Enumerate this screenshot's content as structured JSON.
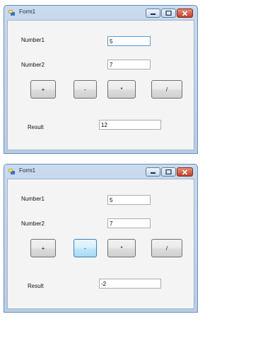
{
  "windows": [
    {
      "title": "Form1",
      "number1_label": "Number1",
      "number1_value": "5",
      "number2_label": "Number2",
      "number2_value": "7",
      "buttons": {
        "add": "+",
        "subtract": "-",
        "multiply": "*",
        "divide": "/"
      },
      "result_label": "Result",
      "result_value": "12"
    },
    {
      "title": "Form1",
      "number1_label": "Number1",
      "number1_value": "5",
      "number2_label": "Number2",
      "number2_value": "7",
      "buttons": {
        "add": "+",
        "subtract": "-",
        "multiply": "*",
        "divide": "/"
      },
      "result_label": "Result",
      "result_value": "-2"
    }
  ],
  "icons": {
    "app": "form-app-icon",
    "minimize": "minimize-icon",
    "maximize": "maximize-icon",
    "close": "close-icon"
  },
  "colors": {
    "titlebar": "#c9daee",
    "client": "#f4f4f4",
    "close_button": "#c2412a",
    "focus_border": "#5b9bd5"
  }
}
